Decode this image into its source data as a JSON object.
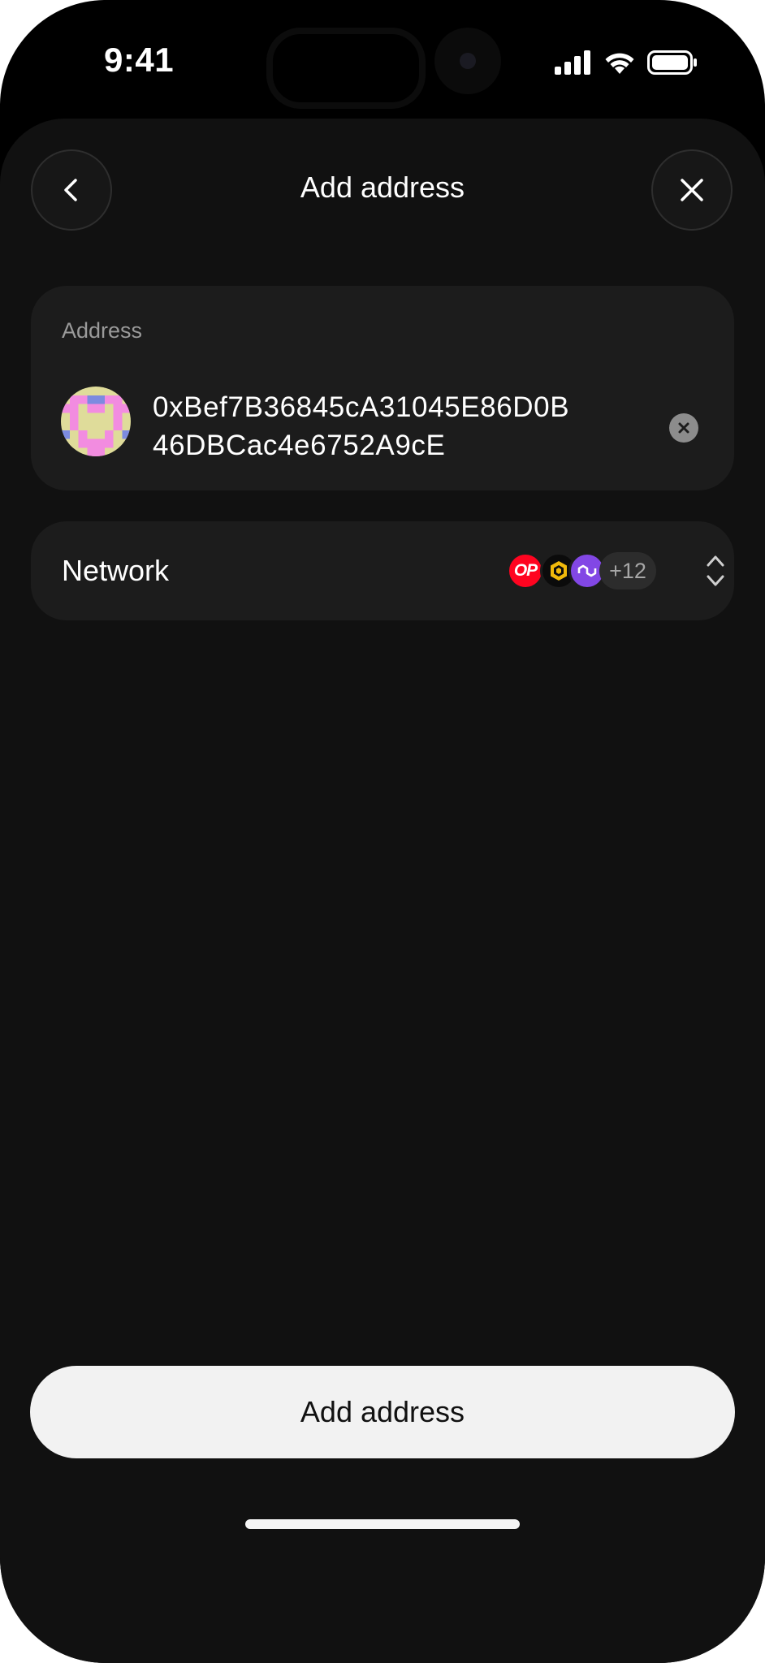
{
  "status_bar": {
    "time": "9:41",
    "icons": [
      "cellular-signal-icon",
      "wifi-icon",
      "battery-icon"
    ]
  },
  "header": {
    "title": "Add address",
    "back_icon": "chevron-left-icon",
    "close_icon": "close-icon"
  },
  "address_field": {
    "label": "Address",
    "value_line1": "0xBef7B36845cA31045E86D0B",
    "value_line2": "46DBCac4e6752A9cE",
    "avatar": "identicon",
    "clear_icon": "clear-circle-icon"
  },
  "network": {
    "label": "Network",
    "icons": [
      "optimism-icon",
      "bnb-chain-icon",
      "polygon-icon"
    ],
    "optimism_mark": "OP",
    "more_count": "+12",
    "expand_icon": "chevron-up-down-icon"
  },
  "footer": {
    "button_label": "Add address"
  },
  "colors": {
    "background": "#111111",
    "card": "#1c1c1c",
    "button": "#f2f2f2",
    "optimism": "#ff0420",
    "polygon": "#8247e5",
    "bnb": "#f0b90b"
  }
}
